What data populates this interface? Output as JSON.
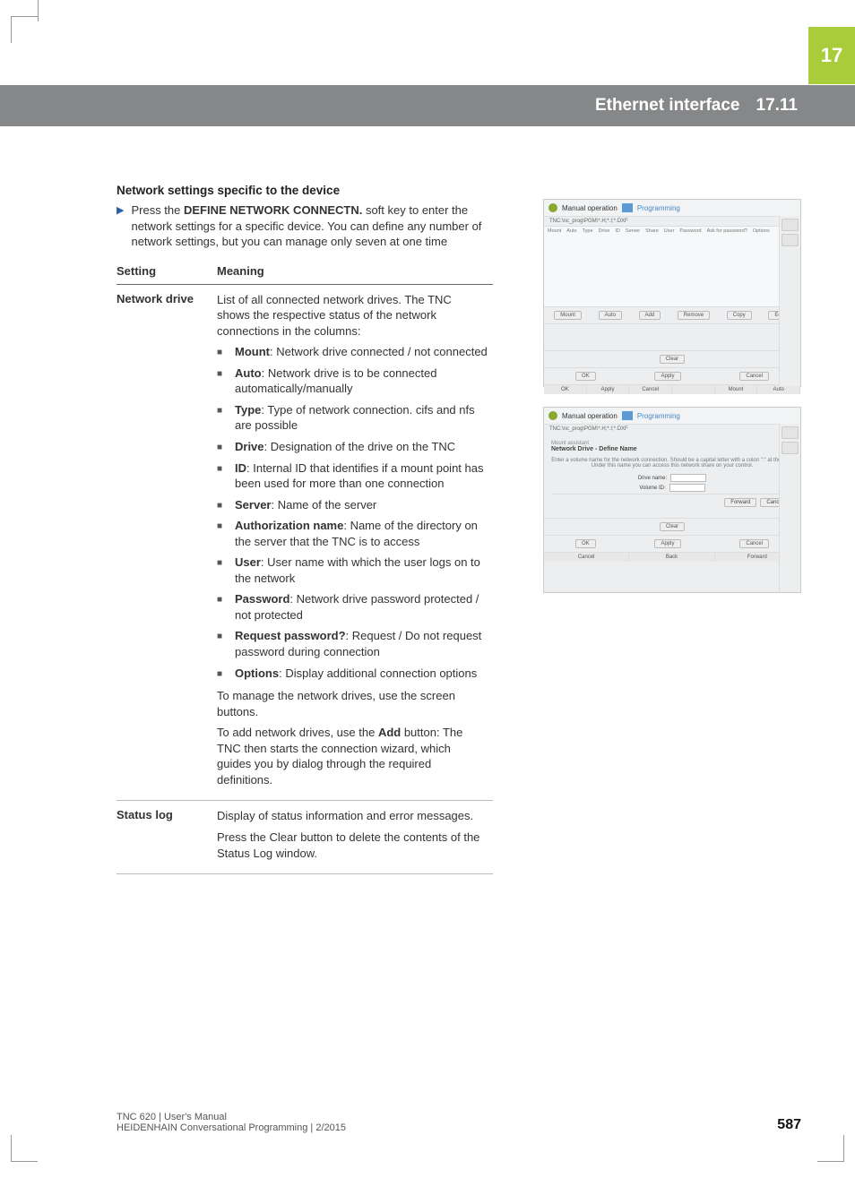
{
  "chapter_tab": "17",
  "header": {
    "title": "Ethernet interface",
    "section": "17.11"
  },
  "intro_heading": "Network settings specific to the device",
  "intro_text_pre": "Press the ",
  "intro_softkey": "DEFINE NETWORK CONNECTN.",
  "intro_text_post": " soft key to enter the network settings for a specific device. You can define any number of network settings, but you can manage only seven at one time",
  "table": {
    "col_setting": "Setting",
    "col_meaning": "Meaning",
    "rows": [
      {
        "setting": "Network drive",
        "intro": "List of all connected network drives. The TNC shows the respective status of the network connections in the columns:",
        "items": [
          {
            "bold": "Mount",
            "text": ": Network drive connected / not connected"
          },
          {
            "bold": "Auto",
            "text": ": Network drive is to be connected automatically/manually"
          },
          {
            "bold": "Type",
            "text": ": Type of network connection. cifs and nfs are possible"
          },
          {
            "bold": "Drive",
            "text": ": Designation of the drive on the TNC"
          },
          {
            "bold": "ID",
            "text": ": Internal ID that identifies if a mount point has been used for more than one connection"
          },
          {
            "bold": "Server",
            "text": ": Name of the server"
          },
          {
            "bold": "Authorization name",
            "text": ": Name of the directory on the server that the TNC is to access"
          },
          {
            "bold": "User",
            "text": ": User name with which the user logs on to the network"
          },
          {
            "bold": "Password",
            "text": ": Network drive password protected / not protected"
          },
          {
            "bold": "Request password?",
            "text": ": Request / Do not request password during connection"
          },
          {
            "bold": "Options",
            "text": ": Display additional connection options"
          }
        ],
        "trailing": [
          "To manage the network drives, use the screen buttons.",
          {
            "pre": "To add network drives, use the ",
            "bold": "Add",
            "post": " button: The TNC then starts the connection wizard, which guides you by dialog through the required definitions."
          }
        ]
      },
      {
        "setting": "Status log",
        "intro": "Display of status information and error messages.",
        "items": [],
        "trailing": [
          "Press the Clear button to delete the contents of the Status Log window."
        ]
      }
    ]
  },
  "figures": {
    "titlebar_mode": "Manual operation",
    "titlebar_prog": "Programming",
    "subbar_line1": "TNC:\\nc_prog\\PGM\\*.H;*.I;*.DXF",
    "cols": [
      "Mount",
      "Auto",
      "Type",
      "Drive",
      "ID",
      "Server",
      "Share",
      "User",
      "Password",
      "Ask for password?",
      "Options"
    ],
    "btns1": [
      "Mount",
      "Auto",
      "Add",
      "Remove",
      "Copy",
      "Edit"
    ],
    "btns2": [
      "Clear"
    ],
    "btns3": [
      "OK",
      "Apply",
      "Cancel"
    ],
    "soft1": [
      "OK",
      "Apply",
      "Cancel",
      "",
      "Mount",
      "Auto"
    ],
    "wizard_title": "Mount assistant",
    "wizard_heading": "Network Drive - Define Name",
    "wizard_hint": "Enter a volume name for the network connection. Should be a capital letter with a colon \":\" at the end. Under this name you can access this network share on your control.",
    "wizard_field1": "Drive name:",
    "wizard_field2": "Volume ID:",
    "wizard_btns": [
      "Forward",
      "Cancel"
    ],
    "soft2": [
      "Cancel",
      "Back",
      "Forward"
    ]
  },
  "footer": {
    "line1": "TNC 620 | User's Manual",
    "line2": "HEIDENHAIN Conversational Programming | 2/2015",
    "page": "587"
  }
}
